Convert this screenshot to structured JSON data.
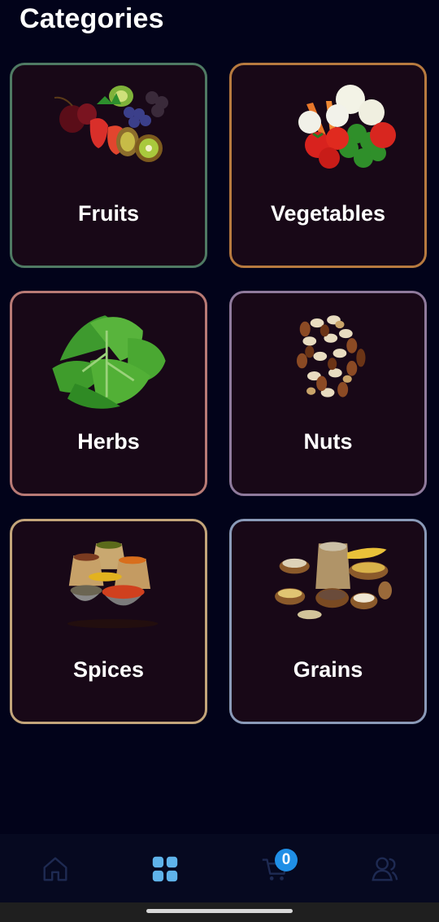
{
  "header": {
    "title": "Categories"
  },
  "categories": [
    {
      "label": "Fruits",
      "border_color": "#4f7a63",
      "icon": "fruits-image"
    },
    {
      "label": "Vegetables",
      "border_color": "#b77a3f",
      "icon": "vegetables-image"
    },
    {
      "label": "Herbs",
      "border_color": "#b87a75",
      "icon": "herbs-image"
    },
    {
      "label": "Nuts",
      "border_color": "#8f7a9c",
      "icon": "nuts-image"
    },
    {
      "label": "Spices",
      "border_color": "#c3a57a",
      "icon": "spices-image"
    },
    {
      "label": "Grains",
      "border_color": "#8a9ab8",
      "icon": "grains-image"
    }
  ],
  "bottom_nav": {
    "items": [
      {
        "icon": "home-icon",
        "active": false
      },
      {
        "icon": "grid-icon",
        "active": true
      },
      {
        "icon": "cart-icon",
        "active": false
      },
      {
        "icon": "users-icon",
        "active": false
      }
    ],
    "cart_count": "0",
    "active_color": "#5fb3ea",
    "inactive_color": "#1e2a52",
    "badge_color": "#1f8fe6"
  },
  "colors": {
    "background": "#02031a",
    "card_background": "#180817",
    "nav_background": "#060920"
  }
}
